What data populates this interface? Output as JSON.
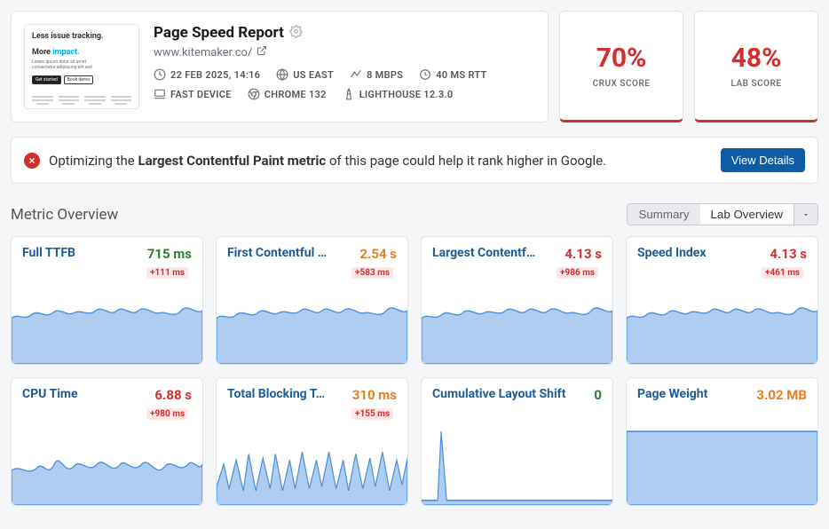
{
  "header": {
    "title": "Page Speed Report",
    "url": "www.kitemaker.co/",
    "meta": {
      "date": "22 FEB 2025, 14:16",
      "region": "US EAST",
      "bandwidth": "8 MBPS",
      "rtt": "40 MS RTT",
      "device": "FAST DEVICE",
      "browser": "CHROME 132",
      "lighthouse": "LIGHTHOUSE 12.3.0"
    },
    "thumb": {
      "line1": "Less issue tracking.",
      "line2a": "More ",
      "line2b": "impact."
    }
  },
  "scores": {
    "crux": {
      "value": "70%",
      "label": "CRUX SCORE"
    },
    "lab": {
      "value": "48%",
      "label": "LAB SCORE"
    }
  },
  "banner": {
    "prefix": "Optimizing the ",
    "strong": "Largest Contentful Paint metric",
    "suffix": " of this page could help it rank higher in Google.",
    "button": "View Details"
  },
  "overview": {
    "title": "Metric Overview",
    "tabs": {
      "summary": "Summary",
      "lab": "Lab Overview"
    }
  },
  "metrics": [
    {
      "name": "Full TTFB",
      "value": "715 ms",
      "delta": "+111 ms",
      "cls": "value-good",
      "spark": "wavy-high"
    },
    {
      "name": "First Contentful …",
      "value": "2.54 s",
      "delta": "+583 ms",
      "cls": "value-warn",
      "spark": "wavy-high"
    },
    {
      "name": "Largest Contentf…",
      "value": "4.13 s",
      "delta": "+986 ms",
      "cls": "value-bad",
      "spark": "wavy-high"
    },
    {
      "name": "Speed Index",
      "value": "4.13 s",
      "delta": "+461 ms",
      "cls": "value-bad",
      "spark": "wavy-high"
    },
    {
      "name": "CPU Time",
      "value": "6.88 s",
      "delta": "+980 ms",
      "cls": "value-bad",
      "spark": "wavy-med"
    },
    {
      "name": "Total Blocking T…",
      "value": "310 ms",
      "delta": "+155 ms",
      "cls": "value-warn",
      "spark": "jagged"
    },
    {
      "name": "Cumulative Layout Shift",
      "value": "0",
      "delta": "",
      "cls": "value-good",
      "spark": "spike"
    },
    {
      "name": "Page Weight",
      "value": "3.02 MB",
      "delta": "",
      "cls": "value-warn",
      "spark": "flat-high"
    }
  ],
  "chart_data": [
    {
      "type": "area",
      "title": "Full TTFB",
      "value_ms": 715,
      "delta_ms": 111
    },
    {
      "type": "area",
      "title": "First Contentful Paint",
      "value_s": 2.54,
      "delta_ms": 583
    },
    {
      "type": "area",
      "title": "Largest Contentful Paint",
      "value_s": 4.13,
      "delta_ms": 986
    },
    {
      "type": "area",
      "title": "Speed Index",
      "value_s": 4.13,
      "delta_ms": 461
    },
    {
      "type": "area",
      "title": "CPU Time",
      "value_s": 6.88,
      "delta_ms": 980
    },
    {
      "type": "area",
      "title": "Total Blocking Time",
      "value_ms": 310,
      "delta_ms": 155
    },
    {
      "type": "area",
      "title": "Cumulative Layout Shift",
      "value": 0
    },
    {
      "type": "area",
      "title": "Page Weight",
      "value_mb": 3.02
    }
  ]
}
